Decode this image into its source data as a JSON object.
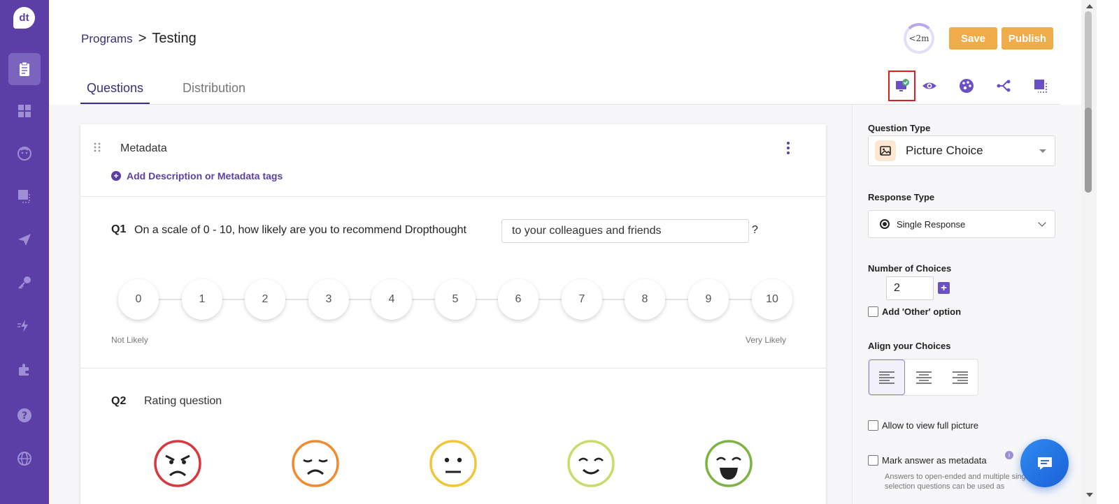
{
  "logo_text": "dt",
  "breadcrumb": {
    "parent": "Programs",
    "separator": ">",
    "current": "Testing"
  },
  "header": {
    "timer": "<2m",
    "save_label": "Save",
    "publish_label": "Publish"
  },
  "tabs": [
    {
      "label": "Questions"
    },
    {
      "label": "Distribution"
    }
  ],
  "metadata": {
    "title": "Metadata",
    "add_desc": "Add Description or Metadata tags"
  },
  "q1": {
    "num": "Q1",
    "text": "On a scale of 0 - 10, how likely are you to recommend Dropthought",
    "input_value": "to your colleagues and friends",
    "qmark": "?",
    "scale": [
      "0",
      "1",
      "2",
      "3",
      "4",
      "5",
      "6",
      "7",
      "8",
      "9",
      "10"
    ],
    "low_label": "Not Likely",
    "high_label": "Very Likely"
  },
  "q2": {
    "num": "Q2",
    "text": "Rating question"
  },
  "right_panel": {
    "question_type_label": "Question Type",
    "question_type_value": "Picture Choice",
    "response_type_label": "Response Type",
    "response_type_value": "Single Response",
    "num_choices_label": "Number of Choices",
    "num_choices_value": "2",
    "add_other": "Add 'Other' option",
    "align_label": "Align your Choices",
    "allow_full": "Allow to view full picture",
    "mark_metadata": "Mark answer as metadata",
    "helper": "Answers to open-ended and multiple single selection questions can be used as"
  },
  "colors": {
    "sidebar": "#5b3fa6",
    "accent": "#3b2e7e",
    "orange": "#f0ac4b",
    "chat": "#1b5fd8"
  }
}
